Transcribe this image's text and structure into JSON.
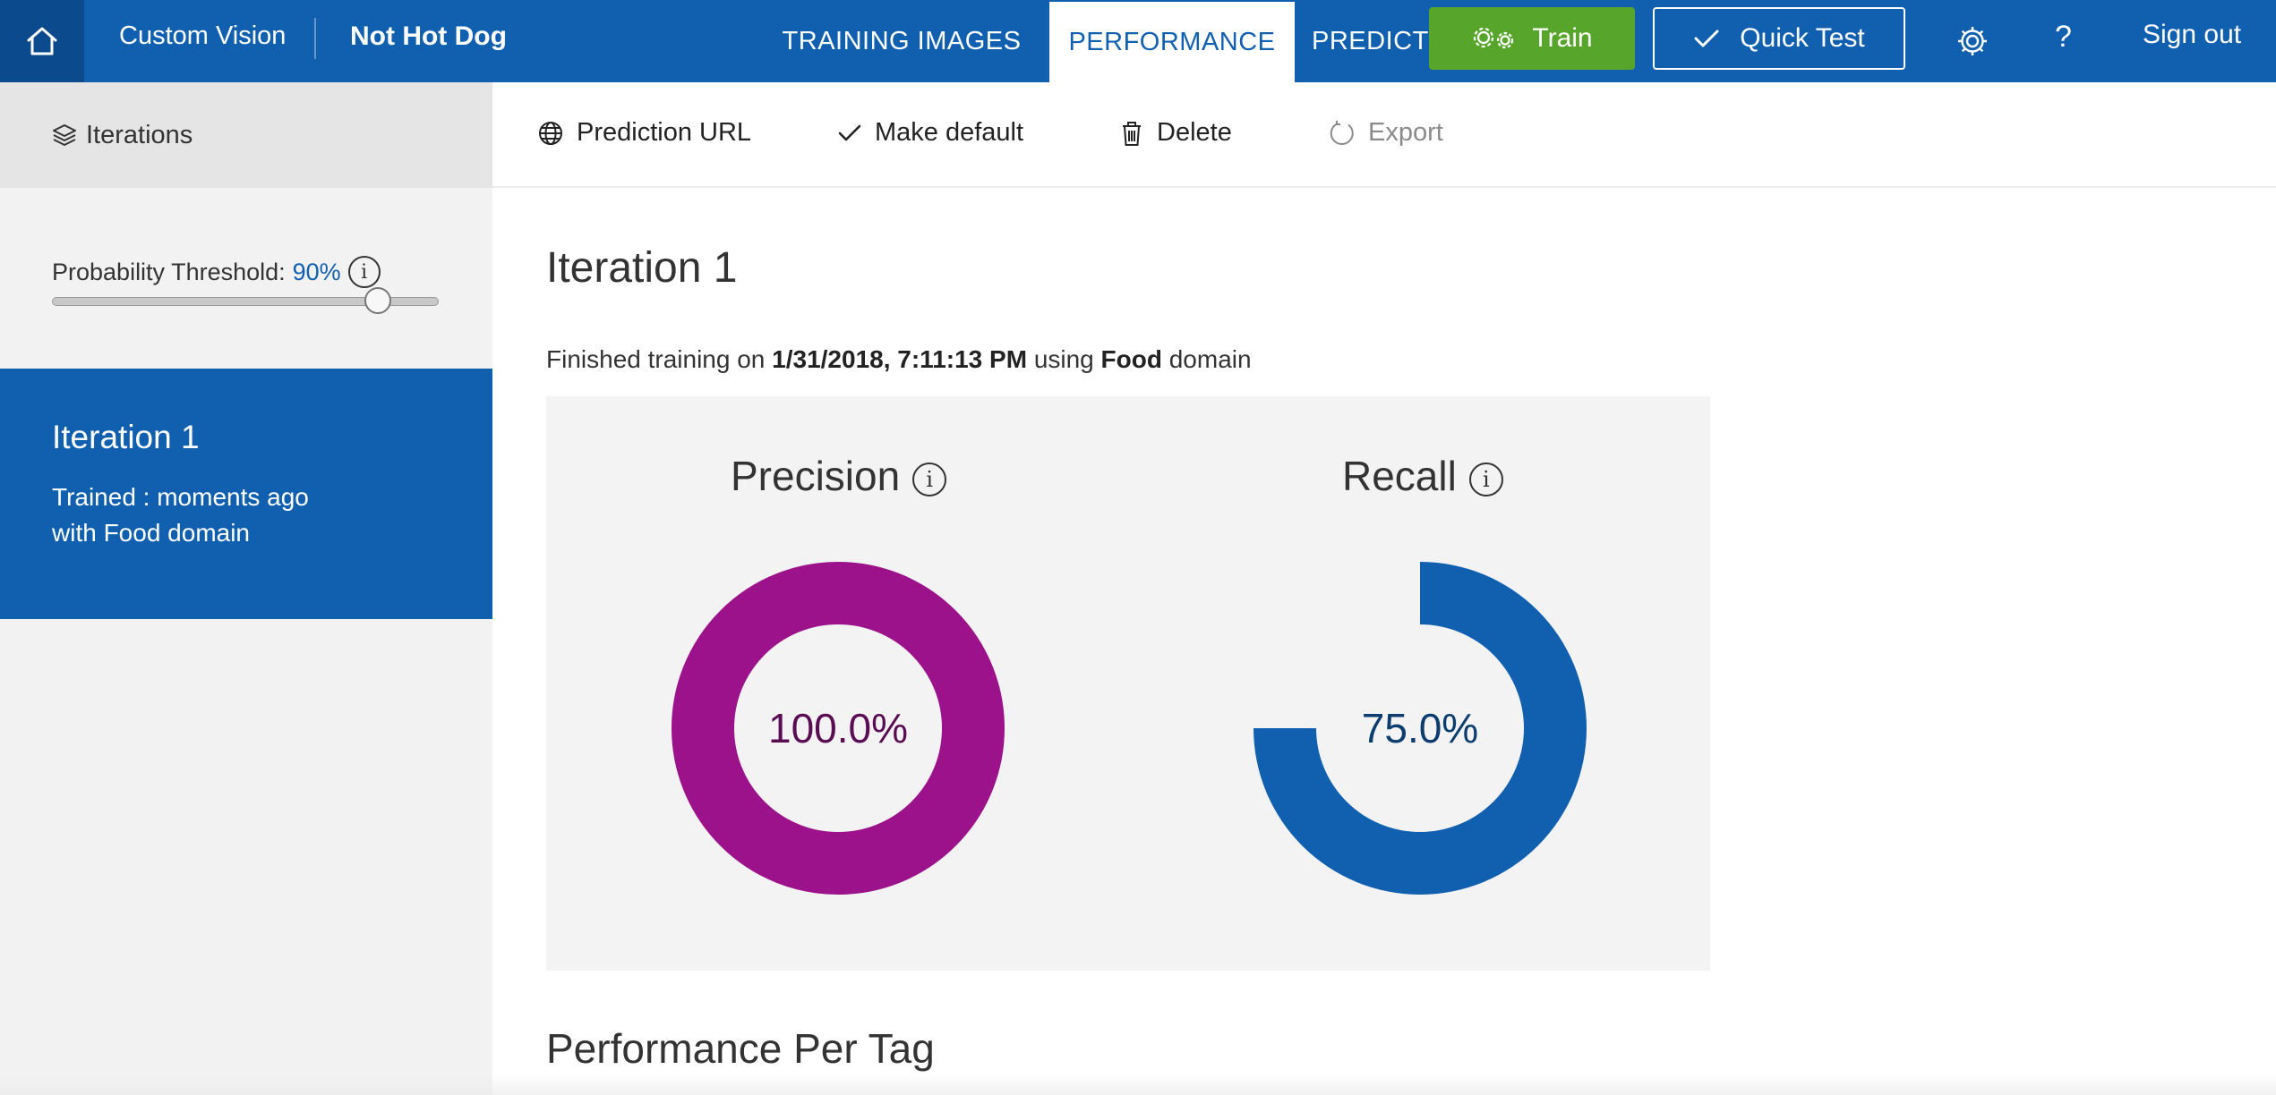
{
  "header": {
    "brand": "Custom Vision",
    "project": "Not Hot Dog",
    "tabs": [
      {
        "label": "TRAINING IMAGES",
        "active": false
      },
      {
        "label": "PERFORMANCE",
        "active": true
      },
      {
        "label": "PREDICT",
        "active": false
      }
    ],
    "train_label": "Train",
    "quick_test_label": "Quick Test",
    "help_label": "?",
    "sign_out_label": "Sign out"
  },
  "sidebar": {
    "heading": "Iterations",
    "threshold_label": "Probability Threshold:",
    "threshold_value": "90%",
    "threshold_level": 0.9,
    "iteration": {
      "title": "Iteration 1",
      "trained": "Trained : moments ago",
      "domain": "with Food domain"
    }
  },
  "commands": {
    "prediction_url": "Prediction URL",
    "make_default": "Make default",
    "delete": "Delete",
    "export": "Export"
  },
  "main": {
    "title": "Iteration 1",
    "finished_prefix": "Finished training on",
    "finished_date": "1/31/2018, 7:11:13 PM",
    "finished_mid": "using",
    "finished_domain": "Food",
    "finished_suffix": "domain",
    "precision_label": "Precision",
    "precision_value": "100.0%",
    "recall_label": "Recall",
    "recall_value": "75.0%",
    "per_tag_title": "Performance Per Tag"
  },
  "chart_data": [
    {
      "type": "pie",
      "title": "Precision",
      "values": [
        100.0,
        0.0
      ],
      "unit": "%"
    },
    {
      "type": "pie",
      "title": "Recall",
      "values": [
        75.0,
        25.0
      ],
      "unit": "%"
    }
  ],
  "colors": {
    "brand_blue": "#1160b0",
    "home_dark": "#0b4a8c",
    "train_green": "#57a62b",
    "precision_purple": "#9b128b",
    "precision_text": "#5a0d52",
    "recall_text": "#0b3d6e",
    "panel_gray": "#f3f3f3"
  },
  "icons": {
    "home": "home-icon",
    "train": "gears-icon",
    "quick_test": "checkmark-icon",
    "settings": "gear-icon",
    "iterations": "layers-icon",
    "prediction_url": "globe-icon",
    "make_default": "checkmark-icon",
    "delete": "trash-icon",
    "export": "refresh-icon",
    "info": "info-icon"
  }
}
